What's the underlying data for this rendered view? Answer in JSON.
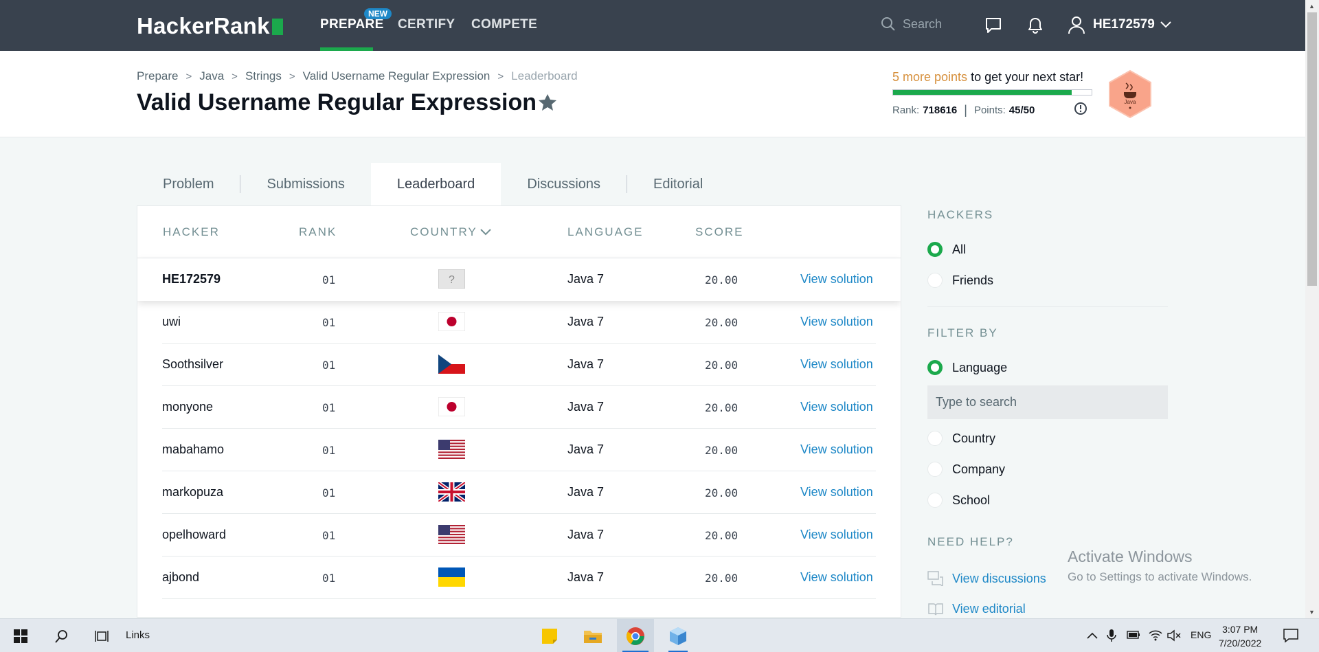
{
  "nav": {
    "logo": "HackerRank",
    "prepare": "PREPARE",
    "new_badge": "NEW",
    "certify": "CERTIFY",
    "compete": "COMPETE",
    "search_placeholder": "Search",
    "username": "HE172579"
  },
  "breadcrumb": {
    "items": [
      "Prepare",
      "Java",
      "Strings",
      "Valid Username Regular Expression"
    ],
    "current": "Leaderboard"
  },
  "page": {
    "title": "Valid Username Regular Expression"
  },
  "progress": {
    "highlight": "5 more points",
    "message": " to get your next star!",
    "rank_label": "Rank:",
    "rank_value": "718616",
    "points_label": "Points:",
    "points_value": "45/50",
    "fraction": 0.9,
    "badge_label": "Java"
  },
  "tabs": [
    "Problem",
    "Submissions",
    "Leaderboard",
    "Discussions",
    "Editorial"
  ],
  "table": {
    "headers": [
      "HACKER",
      "RANK",
      "COUNTRY",
      "LANGUAGE",
      "SCORE"
    ],
    "rows": [
      {
        "hacker": "HE172579",
        "rank": "01",
        "flag": "unknown",
        "language": "Java 7",
        "score": "20.00",
        "action": "View solution"
      },
      {
        "hacker": "uwi",
        "rank": "01",
        "flag": "japan",
        "language": "Java 7",
        "score": "20.00",
        "action": "View solution"
      },
      {
        "hacker": "Soothsilver",
        "rank": "01",
        "flag": "czech",
        "language": "Java 7",
        "score": "20.00",
        "action": "View solution"
      },
      {
        "hacker": "monyone",
        "rank": "01",
        "flag": "japan",
        "language": "Java 7",
        "score": "20.00",
        "action": "View solution"
      },
      {
        "hacker": "mabahamo",
        "rank": "01",
        "flag": "usa",
        "language": "Java 7",
        "score": "20.00",
        "action": "View solution"
      },
      {
        "hacker": "markopuza",
        "rank": "01",
        "flag": "uk",
        "language": "Java 7",
        "score": "20.00",
        "action": "View solution"
      },
      {
        "hacker": "opelhoward",
        "rank": "01",
        "flag": "usa",
        "language": "Java 7",
        "score": "20.00",
        "action": "View solution"
      },
      {
        "hacker": "ajbond",
        "rank": "01",
        "flag": "ukraine",
        "language": "Java 7",
        "score": "20.00",
        "action": "View solution"
      }
    ]
  },
  "sidebar": {
    "hackers_heading": "HACKERS",
    "hackers_options": [
      "All",
      "Friends"
    ],
    "filter_heading": "FILTER BY",
    "filter_options": [
      "Language",
      "Country",
      "Company",
      "School"
    ],
    "language_search_placeholder": "Type to search",
    "help_heading": "NEED HELP?",
    "help_links": [
      "View discussions",
      "View editorial"
    ]
  },
  "watermark": {
    "line1": "Activate Windows",
    "line2": "Go to Settings to activate Windows."
  },
  "taskbar": {
    "links": "Links",
    "language": "ENG",
    "time": "3:07 PM",
    "date": "7/20/2022"
  }
}
